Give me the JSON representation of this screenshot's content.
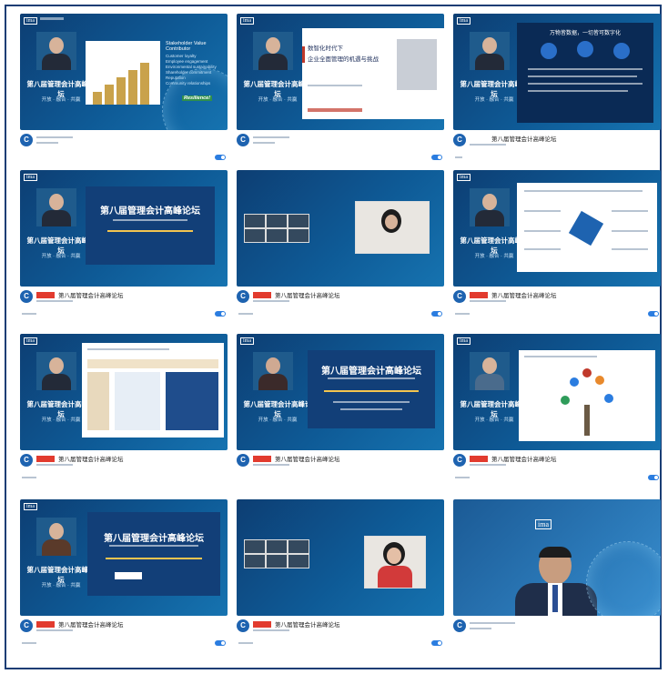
{
  "forum_name": "第八届管理会计高峰论坛",
  "forum_motto": "开放 · 融合 · 共赢",
  "videos": [
    {
      "title": "第八届管理会计高峰论坛",
      "tag": "",
      "stats": "",
      "footer": "",
      "toggle": "",
      "slide_heading": "Stakeholder Value Contributor",
      "slide_items": [
        "Customer loyalty",
        "Employee engagement",
        "Environmental sustainability",
        "Shareholder commitment",
        "Reputation",
        "Community relationships"
      ],
      "slide_badge": "Resilience!"
    },
    {
      "title": "",
      "tag": "",
      "stats": "",
      "footer": "",
      "toggle": "",
      "slide_heading": "数智化时代下",
      "slide_sub": "企业全面管理的机遇与挑战"
    },
    {
      "title": "第八届管理会计高峰论坛",
      "tag": "",
      "stats": "",
      "footer": "",
      "toggle": "",
      "slide_heading": "万物皆数据，一切皆可数字化"
    },
    {
      "title": "第八届管理会计高峰论坛",
      "tag": "",
      "stats": "",
      "footer": "",
      "toggle": "",
      "slide_heading": "第八届管理会计高峰论坛"
    },
    {
      "title": "第八届管理会计高峰论坛",
      "tag": "",
      "stats": "",
      "footer": "",
      "toggle": ""
    },
    {
      "title": "第八届管理会计高峰论坛",
      "tag": "",
      "stats": "",
      "footer": "",
      "toggle": ""
    },
    {
      "title": "第八届管理会计高峰论坛",
      "tag": "",
      "stats": "",
      "footer": "",
      "toggle": ""
    },
    {
      "title": "第八届管理会计高峰论坛",
      "tag": "",
      "stats": "",
      "footer": "",
      "toggle": "",
      "slide_heading": "第八届管理会计高峰论坛"
    },
    {
      "title": "第八届管理会计高峰论坛",
      "tag": "",
      "stats": "",
      "footer": "",
      "toggle": ""
    },
    {
      "title": "第八届管理会计高峰论坛",
      "tag": "",
      "stats": "",
      "footer": "",
      "toggle": "",
      "slide_heading": "第八届管理会计高峰论坛"
    },
    {
      "title": "第八届管理会计高峰论坛",
      "tag": "",
      "stats": "",
      "footer": "",
      "toggle": ""
    },
    {
      "title": "",
      "tag": "",
      "stats": "",
      "footer": "",
      "toggle": "",
      "slide_logo": "ima"
    }
  ],
  "ui": {
    "ima_logo": "ima",
    "avatar_letter": "C"
  }
}
